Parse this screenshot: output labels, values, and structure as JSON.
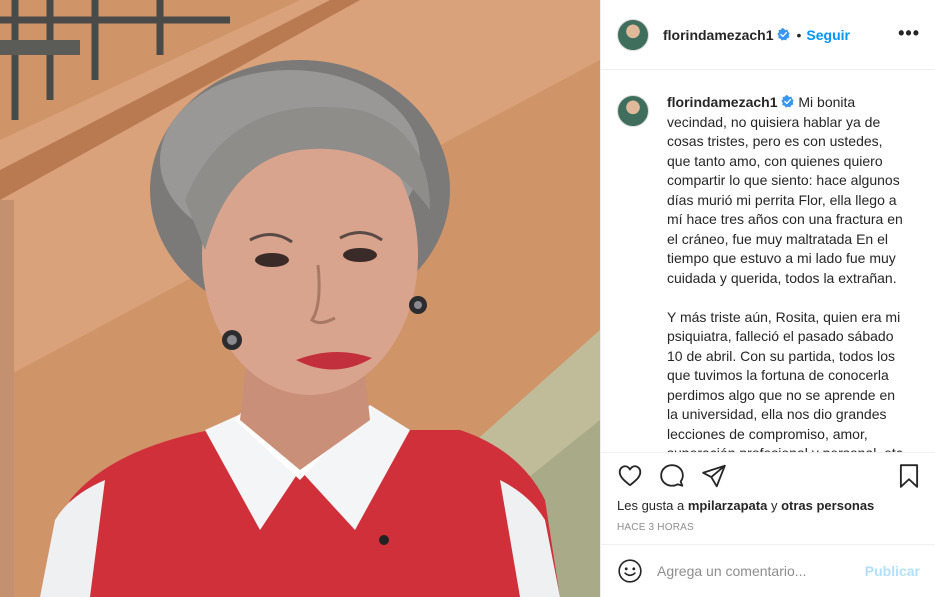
{
  "post": {
    "username": "florindamezach1",
    "verified_icon": "verified-badge-icon",
    "separator": "•",
    "follow_label": "Seguir",
    "more_label": "•••"
  },
  "caption": {
    "username": "florindamezach1",
    "text": "Mi bonita vecindad, no quisiera hablar ya de cosas tristes, pero es con ustedes, que tanto amo, con quienes quiero compartir lo que siento: hace algunos días murió mi perrita Flor, ella llego a mí hace tres años con una fractura en el cráneo, fue muy maltratada En el tiempo que estuvo a mi lado fue muy cuidada y querida, todos la extrañan.\n\nY más triste aún, Rosita, quien era mi psiquiatra, falleció el pasado sábado 10 de abril. Con su partida, todos los que tuvimos la fortuna de conocerla perdimos algo que no se aprende en la universidad, ella nos dio grandes lecciones de compromiso, amor, superación profesional y personal, etc. Era un gran ser humano. Lo lamento"
  },
  "actions": {
    "icons": [
      "heart-icon",
      "comment-icon",
      "share-icon",
      "bookmark-icon"
    ]
  },
  "likes": {
    "prefix": "Les gusta a",
    "user": "mpilarzapata",
    "connector": "y",
    "others": "otras personas"
  },
  "timestamp": "HACE 3 HORAS",
  "comment": {
    "placeholder": "Agrega un comentario...",
    "publish_label": "Publicar",
    "emoji_icon": "emoji-icon"
  },
  "colors": {
    "accent": "#0095f6",
    "publish_disabled": "#b2dffc",
    "muted": "#8e8e8e",
    "text": "#262626",
    "border": "#efefef"
  }
}
